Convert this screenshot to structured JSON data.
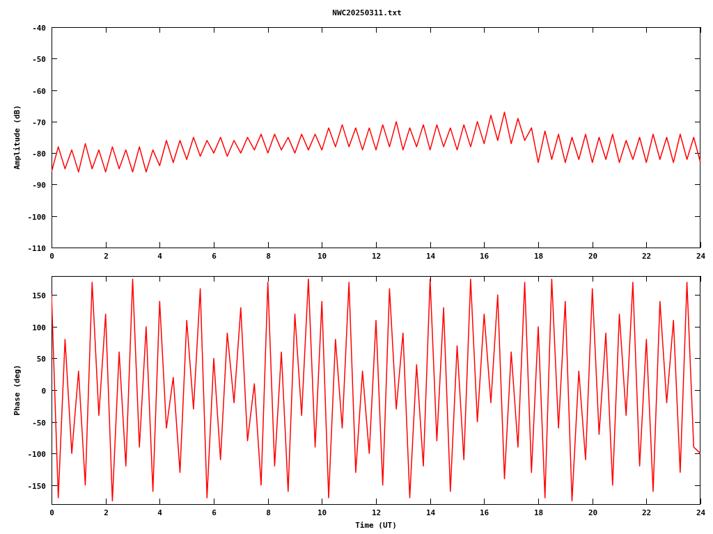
{
  "title": "NWC20250311.txt",
  "charts": [
    {
      "chart_data": {
        "type": "line",
        "ylabel": "Amplitude (dB)",
        "xlim": [
          0,
          24
        ],
        "ylim": [
          -110,
          -40
        ],
        "xticks": [
          0,
          2,
          4,
          6,
          8,
          10,
          12,
          14,
          16,
          18,
          20,
          22,
          24
        ],
        "yticks": [
          -40,
          -50,
          -60,
          -70,
          -80,
          -90,
          -100,
          -110
        ],
        "x": [
          0,
          0.25,
          0.5,
          0.75,
          1,
          1.25,
          1.5,
          1.75,
          2,
          2.25,
          2.5,
          2.75,
          3,
          3.25,
          3.5,
          3.75,
          4,
          4.25,
          4.5,
          4.75,
          5,
          5.25,
          5.5,
          5.75,
          6,
          6.25,
          6.5,
          6.75,
          7,
          7.25,
          7.5,
          7.75,
          8,
          8.25,
          8.5,
          8.75,
          9,
          9.25,
          9.5,
          9.75,
          10,
          10.25,
          10.5,
          10.75,
          11,
          11.25,
          11.5,
          11.75,
          12,
          12.25,
          12.5,
          12.75,
          13,
          13.25,
          13.5,
          13.75,
          14,
          14.25,
          14.5,
          14.75,
          15,
          15.25,
          15.5,
          15.75,
          16,
          16.25,
          16.5,
          16.75,
          17,
          17.25,
          17.5,
          17.75,
          18,
          18.25,
          18.5,
          18.75,
          19,
          19.25,
          19.5,
          19.75,
          20,
          20.25,
          20.5,
          20.75,
          21,
          21.25,
          21.5,
          21.75,
          22,
          22.25,
          22.5,
          22.75,
          23,
          23.25,
          23.5,
          23.75,
          24
        ],
        "series": [
          {
            "color": "#ff0000",
            "values": [
              -86,
              -78,
              -85,
              -79,
              -86,
              -77,
              -85,
              -79,
              -86,
              -78,
              -85,
              -79,
              -86,
              -78,
              -86,
              -79,
              -84,
              -76,
              -83,
              -76,
              -82,
              -75,
              -81,
              -76,
              -80,
              -75,
              -81,
              -76,
              -80,
              -75,
              -79,
              -74,
              -80,
              -74,
              -79,
              -75,
              -80,
              -74,
              -79,
              -74,
              -79,
              -72,
              -78,
              -71,
              -78,
              -72,
              -79,
              -72,
              -79,
              -71,
              -78,
              -70,
              -79,
              -72,
              -78,
              -71,
              -79,
              -71,
              -78,
              -72,
              -79,
              -71,
              -78,
              -70,
              -77,
              -68,
              -76,
              -67,
              -77,
              -69,
              -76,
              -72,
              -83,
              -73,
              -82,
              -74,
              -83,
              -75,
              -82,
              -74,
              -83,
              -75,
              -82,
              -74,
              -83,
              -76,
              -82,
              -75,
              -83,
              -74,
              -82,
              -75,
              -83,
              -74,
              -82,
              -75,
              -83
            ]
          }
        ]
      }
    },
    {
      "chart_data": {
        "type": "line",
        "xlabel": "Time (UT)",
        "ylabel": "Phase (deg)",
        "xlim": [
          0,
          24
        ],
        "ylim": [
          -180,
          180
        ],
        "xticks": [
          0,
          2,
          4,
          6,
          8,
          10,
          12,
          14,
          16,
          18,
          20,
          22,
          24
        ],
        "yticks": [
          150,
          100,
          50,
          0,
          -50,
          -100,
          -150
        ],
        "x": [
          0,
          0.25,
          0.5,
          0.75,
          1,
          1.25,
          1.5,
          1.75,
          2,
          2.25,
          2.5,
          2.75,
          3,
          3.25,
          3.5,
          3.75,
          4,
          4.25,
          4.5,
          4.75,
          5,
          5.25,
          5.5,
          5.75,
          6,
          6.25,
          6.5,
          6.75,
          7,
          7.25,
          7.5,
          7.75,
          8,
          8.25,
          8.5,
          8.75,
          9,
          9.25,
          9.5,
          9.75,
          10,
          10.25,
          10.5,
          10.75,
          11,
          11.25,
          11.5,
          11.75,
          12,
          12.25,
          12.5,
          12.75,
          13,
          13.25,
          13.5,
          13.75,
          14,
          14.25,
          14.5,
          14.75,
          15,
          15.25,
          15.5,
          15.75,
          16,
          16.25,
          16.5,
          16.75,
          17,
          17.25,
          17.5,
          17.75,
          18,
          18.25,
          18.5,
          18.75,
          19,
          19.25,
          19.5,
          19.75,
          20,
          20.25,
          20.5,
          20.75,
          21,
          21.25,
          21.5,
          21.75,
          22,
          22.25,
          22.5,
          22.75,
          23,
          23.25,
          23.5,
          23.75,
          24
        ],
        "series": [
          {
            "color": "#ff0000",
            "values": [
              150,
              -170,
              80,
              -100,
              30,
              -150,
              170,
              -40,
              120,
              -175,
              60,
              -120,
              175,
              -90,
              100,
              -160,
              140,
              -60,
              20,
              -130,
              110,
              -30,
              160,
              -170,
              50,
              -110,
              90,
              -20,
              130,
              -80,
              10,
              -150,
              170,
              -120,
              60,
              -160,
              120,
              -40,
              175,
              -90,
              140,
              -170,
              80,
              -60,
              170,
              -130,
              30,
              -100,
              110,
              -150,
              160,
              -30,
              90,
              -170,
              40,
              -120,
              175,
              -80,
              130,
              -160,
              70,
              -110,
              175,
              -50,
              120,
              -20,
              150,
              -140,
              60,
              -90,
              170,
              -130,
              100,
              -170,
              175,
              -60,
              140,
              -175,
              30,
              -110,
              160,
              -70,
              90,
              -150,
              120,
              -40,
              170,
              -120,
              80,
              -160,
              140,
              -20,
              110,
              -130,
              170,
              -90,
              -100
            ]
          }
        ]
      }
    }
  ]
}
